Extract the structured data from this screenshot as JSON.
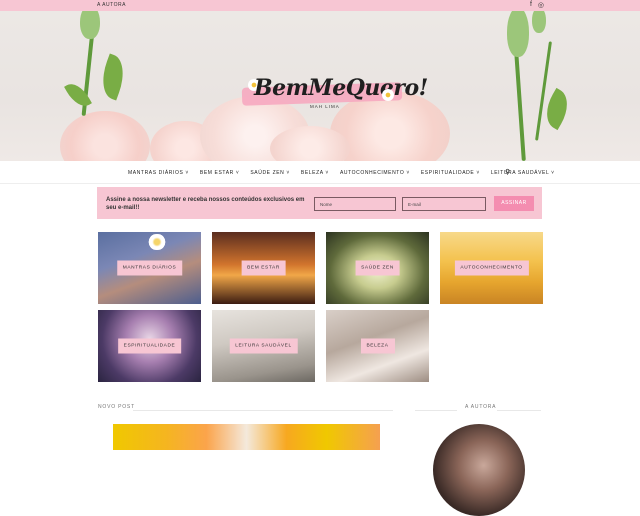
{
  "topbar": {
    "link": "A AUTORA",
    "social": [
      "facebook-icon",
      "instagram-icon"
    ]
  },
  "logo": {
    "title": "BemMeQuero!",
    "subtitle": "MAH LIMA"
  },
  "nav": {
    "items": [
      "MANTRAS DIÁRIOS",
      "BEM ESTAR",
      "SAÚDE ZEN",
      "BELEZA",
      "AUTOCONHECIMENTO",
      "ESPIRITUALIDADE",
      "LEITURA SAUDÁVEL"
    ]
  },
  "newsletter": {
    "text": "Assine a nossa newsletter e receba nossos conteúdos exclusivos em seu e-mail!!",
    "name_placeholder": "Nome",
    "email_placeholder": "E-mail",
    "button": "ASSINAR"
  },
  "categories": [
    "MANTRAS DIÁRIOS",
    "BEM ESTAR",
    "SAÚDE ZEN",
    "AUTOCONHECIMENTO",
    "ESPIRITUALIDADE",
    "LEITURA SAUDÁVEL",
    "BELEZA"
  ],
  "sections": {
    "latest": "NOVO POST",
    "author": "A AUTORA"
  },
  "colors": {
    "accent": "#f7c6d3",
    "button": "#f48db0"
  }
}
